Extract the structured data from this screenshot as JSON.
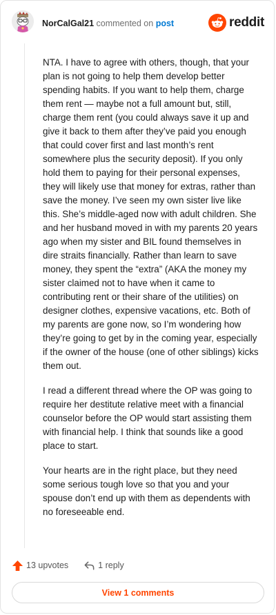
{
  "header": {
    "author": "NorCalGal21",
    "commented_text": "commented on",
    "post_link": "post",
    "brand": "reddit"
  },
  "comment": {
    "paragraphs": [
      "NTA. I have to agree with others, though, that your plan is not going to help them develop better spending habits. If you want to help them, charge them rent — maybe not a full amount but, still, charge them rent (you could always save it up and give it back to them after they’ve paid you enough that could cover first and last month’s rent somewhere plus the security deposit). If you only hold them to paying for their personal expenses, they will likely use that money for extras, rather than save the money. I’ve seen my own sister live like this. She’s middle-aged now with adult children. She and her husband moved in with my parents 20 years ago when my sister and BIL found themselves in dire straits financially. Rather than learn to save money, they spent the “extra” (AKA the money my sister claimed not to have when it came to contributing rent or their share of the utilities) on designer clothes, expensive vacations, etc. Both of my parents are gone now, so I’m wondering how they’re going to get by in the coming year, especially if the owner of the house (one of other siblings) kicks them out.",
      "I read a different thread where the OP was going to require her destitute relative meet with a financial counselor before the OP would start assisting them with financial help. I think that sounds like a good place to start.",
      "Your hearts are in the right place, but they need some serious tough love so that you and your spouse don’t end up with them as dependents with no foreseeable end."
    ]
  },
  "actions": {
    "upvotes": "13 upvotes",
    "replies": "1 reply"
  },
  "view_comments_label": "View 1 comments",
  "colors": {
    "accent": "#ff4500",
    "link": "#0079d3"
  },
  "icons": {
    "avatar": "snoo-avatar",
    "brand": "reddit-logo-icon",
    "upvote": "upvote-arrow-icon",
    "reply": "reply-arrow-icon"
  }
}
